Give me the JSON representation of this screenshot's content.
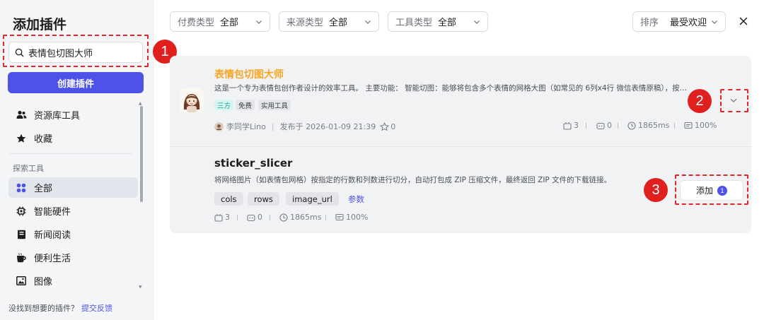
{
  "sidebar": {
    "title": "添加插件",
    "search_value": "表情包切图大师",
    "create_label": "创建插件",
    "top_items": [
      {
        "label": "资源库工具",
        "icon": "users-icon"
      },
      {
        "label": "收藏",
        "icon": "star-icon"
      }
    ],
    "section_label": "探索工具",
    "explore_items": [
      {
        "label": "全部",
        "icon": "grid-icon",
        "active": true
      },
      {
        "label": "智能硬件",
        "icon": "chip-icon"
      },
      {
        "label": "新闻阅读",
        "icon": "book-icon"
      },
      {
        "label": "便利生活",
        "icon": "coffee-icon"
      },
      {
        "label": "图像",
        "icon": "image-icon"
      }
    ],
    "feedback_text": "没找到想要的插件？",
    "feedback_link": "提交反馈"
  },
  "filters": {
    "pay": {
      "label": "付费类型",
      "value": "全部"
    },
    "source": {
      "label": "来源类型",
      "value": "全部"
    },
    "tool": {
      "label": "工具类型",
      "value": "全部"
    },
    "sort": {
      "label": "排序",
      "value": "最受欢迎"
    }
  },
  "plugin": {
    "title": "表情包切图大师",
    "description": "这是一个专为表情包创作者设计的效率工具。 主要功能： 智能切图：能够将包含多个表情的网格大图（如常见的 6列x4行 微信表情原稿），按…",
    "tags": [
      "三方",
      "免费",
      "实用工具"
    ],
    "author": "李同学Lino",
    "published": "发布于 2026-01-09 21:39",
    "favorites": "0",
    "stats": {
      "tools": "3",
      "calls": "0",
      "latency": "1865ms",
      "success": "100%"
    }
  },
  "tool": {
    "name": "sticker_slicer",
    "description": "将网络图片（如表情包网格）按指定的行数和列数进行切分，自动打包成 ZIP 压缩文件，最终返回 ZIP 文件的下载链接。",
    "params": [
      "cols",
      "rows",
      "image_url"
    ],
    "params_link": "参数",
    "stats": {
      "tools": "3",
      "calls": "0",
      "latency": "1865ms",
      "success": "100%"
    },
    "add_label": "添加",
    "add_count": "1"
  },
  "annotations": [
    "1",
    "2",
    "3"
  ],
  "colors": {
    "accent": "#4d53e8",
    "plugin_title": "#f5a623",
    "annotation": "#e0201f"
  }
}
